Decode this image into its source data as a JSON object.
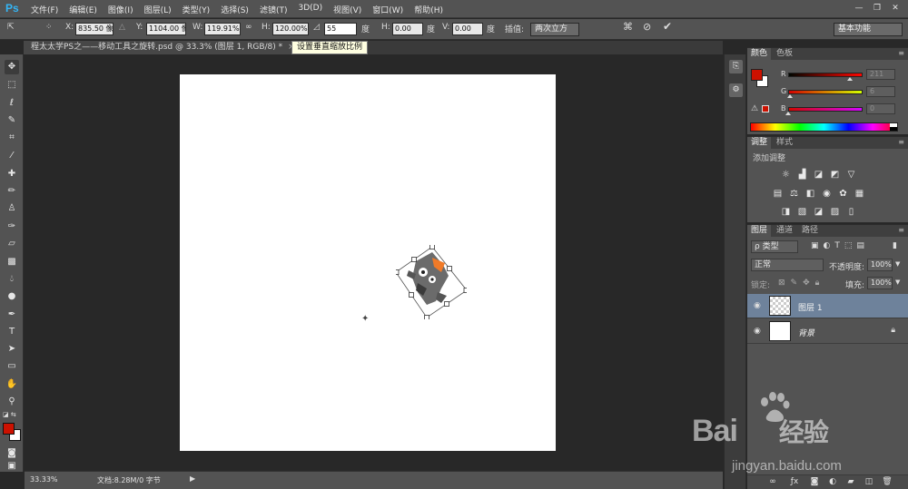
{
  "app": {
    "logo": "Ps"
  },
  "menu": [
    "文件(F)",
    "编辑(E)",
    "图像(I)",
    "图层(L)",
    "类型(Y)",
    "选择(S)",
    "滤镜(T)",
    "3D(D)",
    "视图(V)",
    "窗口(W)",
    "帮助(H)"
  ],
  "window": {
    "minimize": "—",
    "restore": "❐",
    "close": "✕"
  },
  "options": {
    "x_label": "X:",
    "x_value": "835.50 像素",
    "y_label": "Y:",
    "y_value": "1104.00 像素",
    "w_label": "W:",
    "w_value": "119.91%",
    "h_label": "H:",
    "h_value": "120.00%",
    "angle_value": "55",
    "angle_unit": "度",
    "hskew_label": "H:",
    "hskew_value": "0.00",
    "hskew_unit": "度",
    "vskew_label": "V:",
    "vskew_value": "0.00",
    "vskew_unit": "度",
    "interp_label": "插值:",
    "interp_value": "两次立方",
    "workspace": "基本功能"
  },
  "document": {
    "tab_title": "程太太学PS之——移动工具之旋转.psd @ 33.3% (图层 1, RGB/8) *",
    "tab_close": "×",
    "tooltip": "设置垂直缩放比例"
  },
  "status": {
    "zoom": "33.33%",
    "docinfo": "文档:8.28M/0 字节",
    "arrow": "▶"
  },
  "color_panel": {
    "tabs": [
      "颜色",
      "色板"
    ],
    "fg_color": "#cc1100",
    "bg_color": "#ffffff",
    "channels": [
      {
        "label": "R",
        "value": "211",
        "fraction": 0.827
      },
      {
        "label": "G",
        "value": "6",
        "fraction": 0.024
      },
      {
        "label": "B",
        "value": "0",
        "fraction": 0.0
      }
    ]
  },
  "adjust_panel": {
    "tabs": [
      "调整",
      "样式"
    ],
    "title": "添加调整"
  },
  "layers_panel": {
    "tabs": [
      "图层",
      "通道",
      "路径"
    ],
    "filter": "ρ 类型",
    "blend_mode": "正常",
    "opacity_label": "不透明度:",
    "opacity_value": "100%",
    "lock_label": "锁定:",
    "fill_label": "填充:",
    "fill_value": "100%",
    "layers": [
      {
        "name": "图层 1",
        "selected": true
      },
      {
        "name": "背景",
        "selected": false
      }
    ]
  },
  "watermark": {
    "brand": "Bai",
    "brand2": "经验",
    "url": "jingyan.baidu.com"
  }
}
